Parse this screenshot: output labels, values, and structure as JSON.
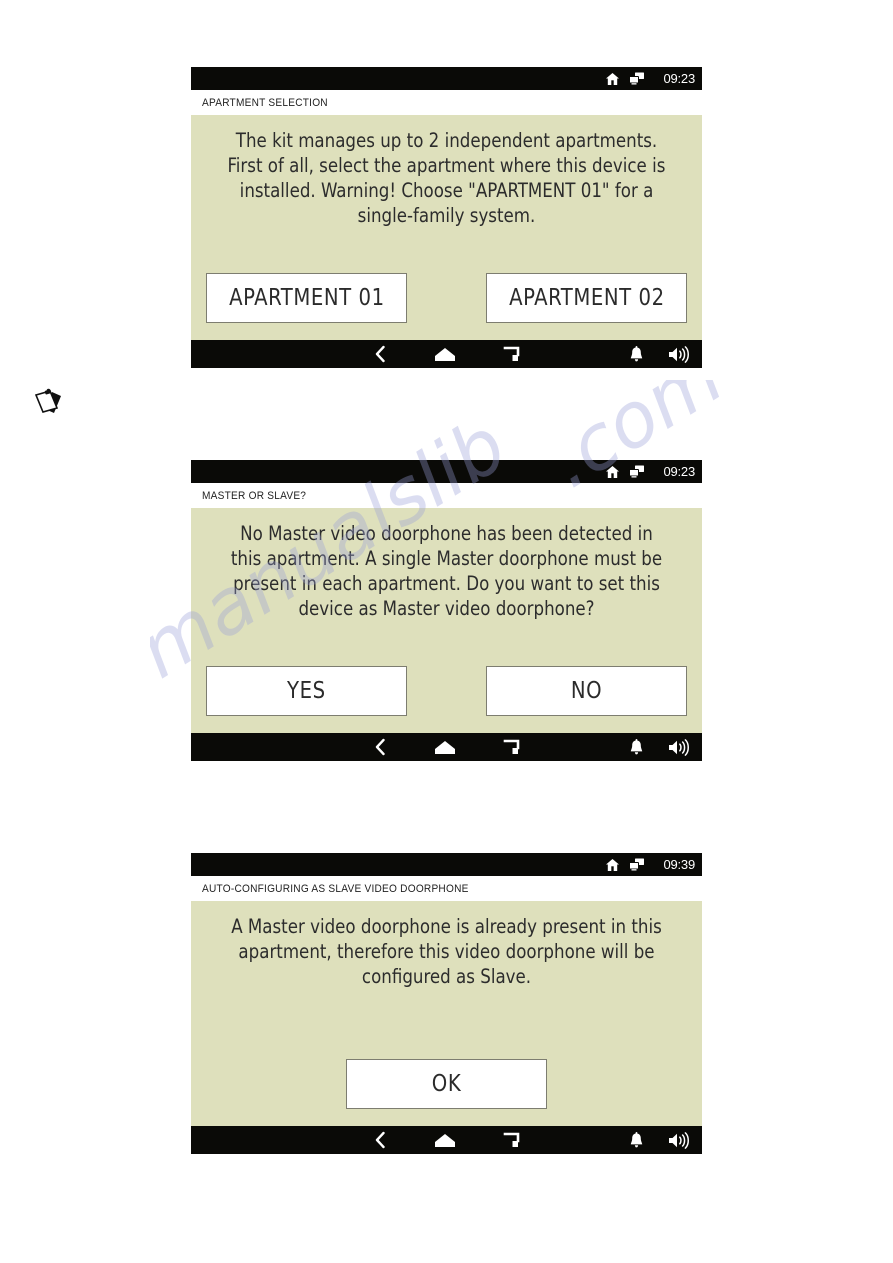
{
  "page": {
    "background_color": "#ffffff",
    "panel_color": "#dee0bc",
    "bar_color": "#0a0a07",
    "button_fill": "#ffffff",
    "button_border": "#7d7d70",
    "text_color": "#2c2c2c"
  },
  "margin_note": {
    "icon": "clipboard-note-icon"
  },
  "watermark": {
    "line1": "manualslib",
    "line2": ".com"
  },
  "screens": [
    {
      "id": "apartment-selection",
      "status_bar": {
        "time": "09:23",
        "icons": [
          "home-icon",
          "screens-network-icon"
        ]
      },
      "title": "APARTMENT SELECTION",
      "message": "The kit manages up to 2 independent apartments. First of all, select the apartment where this device is installed. Warning! Choose \"APARTMENT 01\" for a single-family system.",
      "buttons": [
        {
          "label": "APARTMENT 01",
          "name": "apartment-01-button"
        },
        {
          "label": "APARTMENT 02",
          "name": "apartment-02-button"
        }
      ],
      "nav_bar": {
        "center_icons": [
          "back-icon",
          "home-icon",
          "recent-apps-icon"
        ],
        "right_icons": [
          "bell-icon",
          "volume-icon"
        ]
      }
    },
    {
      "id": "master-or-slave",
      "status_bar": {
        "time": "09:23",
        "icons": [
          "home-icon",
          "screens-network-icon"
        ]
      },
      "title": "MASTER OR SLAVE?",
      "message": "No Master video doorphone has been detected in this apartment. A single Master doorphone must be present in each apartment. Do you want to set this device as Master video doorphone?",
      "buttons": [
        {
          "label": "YES",
          "name": "yes-button"
        },
        {
          "label": "NO",
          "name": "no-button"
        }
      ],
      "nav_bar": {
        "center_icons": [
          "back-icon",
          "home-icon",
          "recent-apps-icon"
        ],
        "right_icons": [
          "bell-icon",
          "volume-icon"
        ]
      }
    },
    {
      "id": "auto-configuring-slave",
      "status_bar": {
        "time": "09:39",
        "icons": [
          "home-icon",
          "screens-network-icon"
        ]
      },
      "title": "AUTO-CONFIGURING AS SLAVE VIDEO DOORPHONE",
      "message": "A Master video doorphone is already present in this apartment, therefore this video doorphone will be configured as Slave.",
      "buttons": [
        {
          "label": "OK",
          "name": "ok-button"
        }
      ],
      "nav_bar": {
        "center_icons": [
          "back-icon",
          "home-icon",
          "recent-apps-icon"
        ],
        "right_icons": [
          "bell-icon",
          "volume-icon"
        ]
      }
    }
  ]
}
